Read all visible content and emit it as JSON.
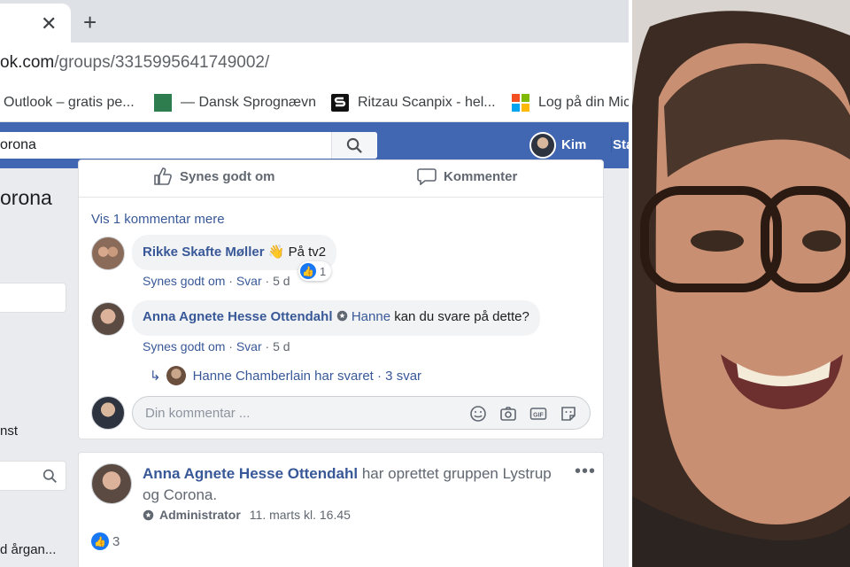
{
  "browser": {
    "tab_close": "✕",
    "new_tab": "+",
    "url_host": "ok.com",
    "url_path": "/groups/3315995641749002/",
    "bookmarks": [
      {
        "label": "Outlook – gratis pe...",
        "icon": "outlook-icon"
      },
      {
        "label": "— Dansk Sprognævn",
        "icon": "green-square-icon"
      },
      {
        "label": "Ritzau Scanpix - hel...",
        "icon": "scanpix-icon"
      },
      {
        "label": "Log på din Mic",
        "icon": "microsoft-icon"
      }
    ]
  },
  "fb_header": {
    "search_value": "orona",
    "user_name": "Kim",
    "nav_start": "Sta"
  },
  "sidebar": {
    "group_title": "orona",
    "item_nst": "nst",
    "item_argan": "d årgan..."
  },
  "post1": {
    "like_action": "Synes godt om",
    "comment_action": "Kommenter",
    "more_comments": "Vis 1 kommentar mere",
    "comments": [
      {
        "author": "Rikke Skafte Møller",
        "text": "På tv2",
        "meta_like": "Synes godt om",
        "meta_reply": "Svar",
        "meta_time": "5 d",
        "reactions": "1"
      },
      {
        "author": "Anna Agnete Hesse Ottendahl",
        "tag": "Hanne",
        "text": "kan du svare på dette?",
        "meta_like": "Synes godt om",
        "meta_reply": "Svar",
        "meta_time": "5 d"
      }
    ],
    "reply_summary": "Hanne Chamberlain har svaret · 3 svar",
    "comment_placeholder": "Din kommentar ..."
  },
  "post2": {
    "author": "Anna Agnete Hesse Ottendahl",
    "action_text": "har oprettet gruppen Lystrup og Corona.",
    "role": "Administrator",
    "timestamp": "11. marts kl. 16.45",
    "likes": "3",
    "more": "•••"
  },
  "colors": {
    "facebook_blue": "#4267b2",
    "link_blue": "#385898",
    "like_blue": "#1877f2"
  }
}
